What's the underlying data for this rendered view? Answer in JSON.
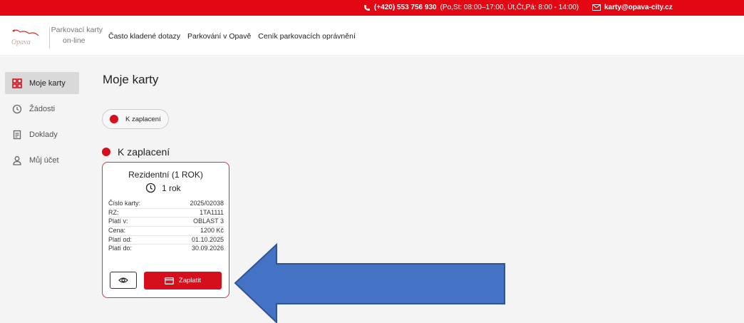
{
  "topbar": {
    "phone": "(+420) 553 756 930",
    "hours": "(Po,St: 08:00–17:00, Út,Čt,Pá: 8:00 - 14:00)",
    "email": "karty@opava-city.cz"
  },
  "header": {
    "logo_text": "Opava",
    "brand_line1": "Parkovací karty",
    "brand_line2": "on-line",
    "nav": [
      "Často kladené dotazy",
      "Parkování v Opavě",
      "Ceník parkovacích oprávnění"
    ]
  },
  "sidebar": {
    "items": [
      {
        "label": "Moje karty",
        "icon": "grid-icon",
        "active": true
      },
      {
        "label": "Žádosti",
        "icon": "clock-icon",
        "active": false
      },
      {
        "label": "Doklady",
        "icon": "receipt-icon",
        "active": false
      },
      {
        "label": "Můj účet",
        "icon": "user-icon",
        "active": false
      }
    ]
  },
  "main": {
    "title": "Moje karty",
    "filter_chip": "K zaplacení",
    "section_heading": "K zaplacení"
  },
  "card": {
    "title": "Rezidentní (1 ROK)",
    "duration": "1 rok",
    "rows": [
      {
        "label": "Číslo karty:",
        "value": "2025/02038"
      },
      {
        "label": "RZ:",
        "value": "1TA1111"
      },
      {
        "label": "Platí v:",
        "value": "OBLAST 3"
      },
      {
        "label": "Cena:",
        "value": "1200 Kč"
      },
      {
        "label": "Platí od:",
        "value": "01.10.2025"
      },
      {
        "label": "Platí do:",
        "value": "30.09.2026"
      }
    ],
    "pay_label": "Zaplatit"
  },
  "colors": {
    "brand_red": "#e30613",
    "status_red": "#d50f1c",
    "annotation_arrow": "#4472c4"
  }
}
